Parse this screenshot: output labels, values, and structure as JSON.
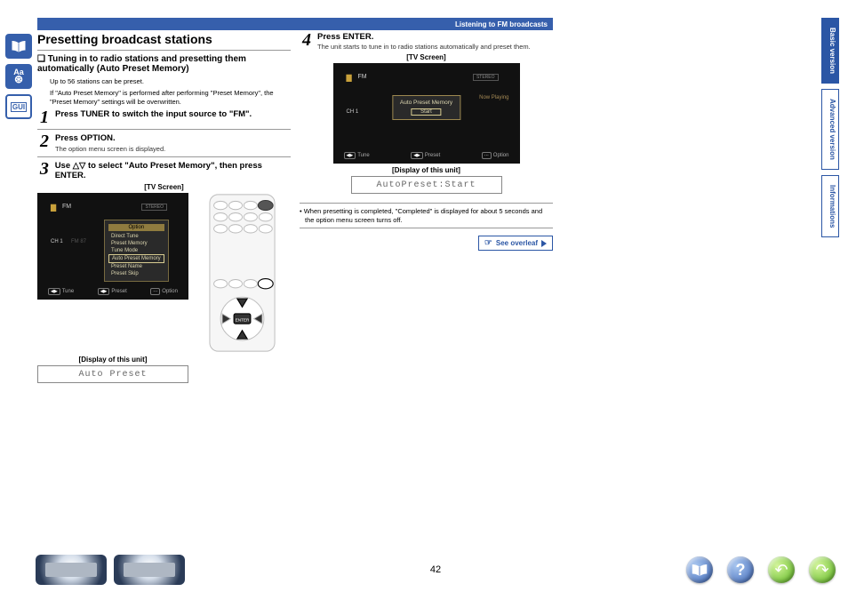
{
  "header": {
    "breadcrumb": "Listening to FM broadcasts"
  },
  "left_tools": {
    "book": "book-icon",
    "dict": "Aa",
    "gui": "GUI"
  },
  "col1": {
    "title": "Presetting broadcast stations",
    "sub": "Tuning in to radio stations and presetting them automatically (Auto Preset Memory)",
    "intro1": "Up to 56 stations can be preset.",
    "intro2": "If \"Auto Preset Memory\" is performed after performing \"Preset Memory\", the \"Preset Memory\" settings will be overwritten.",
    "step1": "Press TUNER to switch the input source to \"FM\".",
    "step2": "Press OPTION.",
    "step2_note": "The option menu screen is displayed.",
    "step3": "Use △▽ to select \"Auto Preset Memory\", then press ENTER.",
    "tv_caption": "[TV Screen]",
    "unit_caption": "[Display of this unit]",
    "lcd_text": "Auto Preset",
    "tv": {
      "fm": "FM",
      "ch": "CH 1",
      "freq": " FM 87",
      "stereo": "STEREO",
      "menu_head": "Option",
      "items": [
        "Direct Tune",
        "Preset Memory",
        "Tune Mode",
        "Auto Preset Memory",
        "Preset Name",
        "Preset Skip"
      ],
      "b1": "Tune",
      "b2": "Preset",
      "b3": "Option"
    }
  },
  "col2": {
    "step4": "Press ENTER.",
    "step4_note": "The unit starts to tune in to radio stations automatically and preset them.",
    "tv_caption": "[TV Screen]",
    "unit_caption": "[Display of this unit]",
    "lcd_text": "AutoPreset:Start",
    "tv": {
      "fm": "FM",
      "ch": "CH 1",
      "stereo": "STEREO",
      "np": "Now Playing",
      "dlg_title": "Auto Preset Memory",
      "dlg_btn": "Start",
      "b1": "Tune",
      "b2": "Preset",
      "b3": "Option"
    },
    "note": "When presetting is completed, \"Completed\" is displayed for about 5 seconds and the option menu screen turns off.",
    "see": "See overleaf"
  },
  "tabs": {
    "t1": "Basic version",
    "t2": "Advanced version",
    "t3": "Informations"
  },
  "footer": {
    "page": "42"
  }
}
